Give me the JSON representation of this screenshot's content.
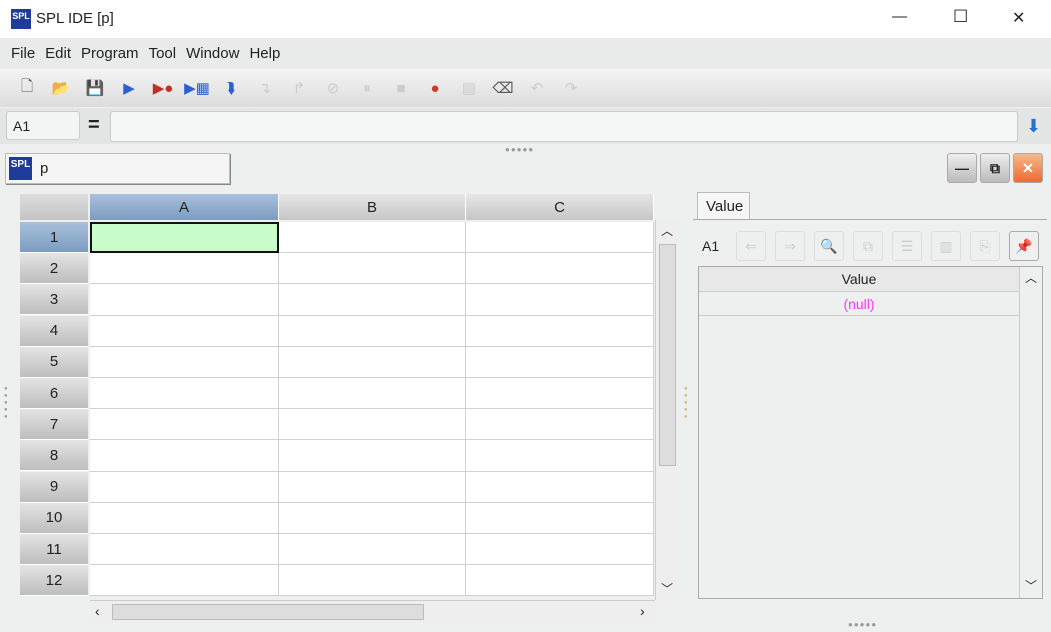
{
  "window": {
    "title": "SPL IDE  [p]",
    "logo": "SPL",
    "minimize": "—",
    "maximize": "☐",
    "close": "✕"
  },
  "menu": [
    "File",
    "Edit",
    "Program",
    "Tool",
    "Window",
    "Help"
  ],
  "toolbar": [
    {
      "icon": "new-file-icon",
      "glyph": "🗋",
      "enabled": true
    },
    {
      "icon": "open-folder-icon",
      "glyph": "📂",
      "enabled": true
    },
    {
      "icon": "save-icon",
      "glyph": "💾",
      "enabled": false
    },
    {
      "icon": "run-icon",
      "glyph": "▶",
      "enabled": true
    },
    {
      "icon": "debug-run-icon",
      "glyph": "▶●",
      "enabled": true
    },
    {
      "icon": "run-to-cursor-icon",
      "glyph": "▶▦",
      "enabled": true
    },
    {
      "icon": "step-icon",
      "glyph": "⮯",
      "enabled": true
    },
    {
      "icon": "step-into-icon",
      "glyph": "↴",
      "enabled": false
    },
    {
      "icon": "step-out-icon",
      "glyph": "↱",
      "enabled": false
    },
    {
      "icon": "stop-icon",
      "glyph": "⊘",
      "enabled": false
    },
    {
      "icon": "pause-icon",
      "glyph": "⏸",
      "enabled": false
    },
    {
      "icon": "square-stop-icon",
      "glyph": "■",
      "enabled": false
    },
    {
      "icon": "breakpoint-icon",
      "glyph": "●",
      "enabled": true
    },
    {
      "icon": "calculator-icon",
      "glyph": "▤",
      "enabled": false
    },
    {
      "icon": "eraser-icon",
      "glyph": "⌫",
      "enabled": true
    },
    {
      "icon": "undo-icon",
      "glyph": "↶",
      "enabled": false
    },
    {
      "icon": "redo-icon",
      "glyph": "↷",
      "enabled": false
    }
  ],
  "formula": {
    "cell_ref": "A1",
    "equals": "=",
    "value": "",
    "submit_icon": "⬇"
  },
  "sheet": {
    "tab_label": "p",
    "logo": "SPL",
    "columns": [
      "A",
      "B",
      "C"
    ],
    "rows": [
      "1",
      "2",
      "3",
      "4",
      "5",
      "6",
      "7",
      "8",
      "9",
      "10",
      "11",
      "12"
    ],
    "selected": "A1"
  },
  "panel": {
    "tab": "Value",
    "cell_ref": "A1",
    "column_header": "Value",
    "value": "(null)",
    "buttons": [
      {
        "icon": "back-icon",
        "glyph": "⇐"
      },
      {
        "icon": "forward-icon",
        "glyph": "⇒"
      },
      {
        "icon": "inspect-icon",
        "glyph": "🔍"
      },
      {
        "icon": "copy-icon",
        "glyph": "⧉"
      },
      {
        "icon": "list-icon",
        "glyph": "☰"
      },
      {
        "icon": "chart-icon",
        "glyph": "▥"
      },
      {
        "icon": "export-icon",
        "glyph": "⎘"
      },
      {
        "icon": "pin-icon",
        "glyph": "📌"
      }
    ]
  },
  "colors": {
    "selected_cell": "#c8fcc8",
    "null_value": "#ff33ff",
    "accent": "#7b9cc0"
  }
}
